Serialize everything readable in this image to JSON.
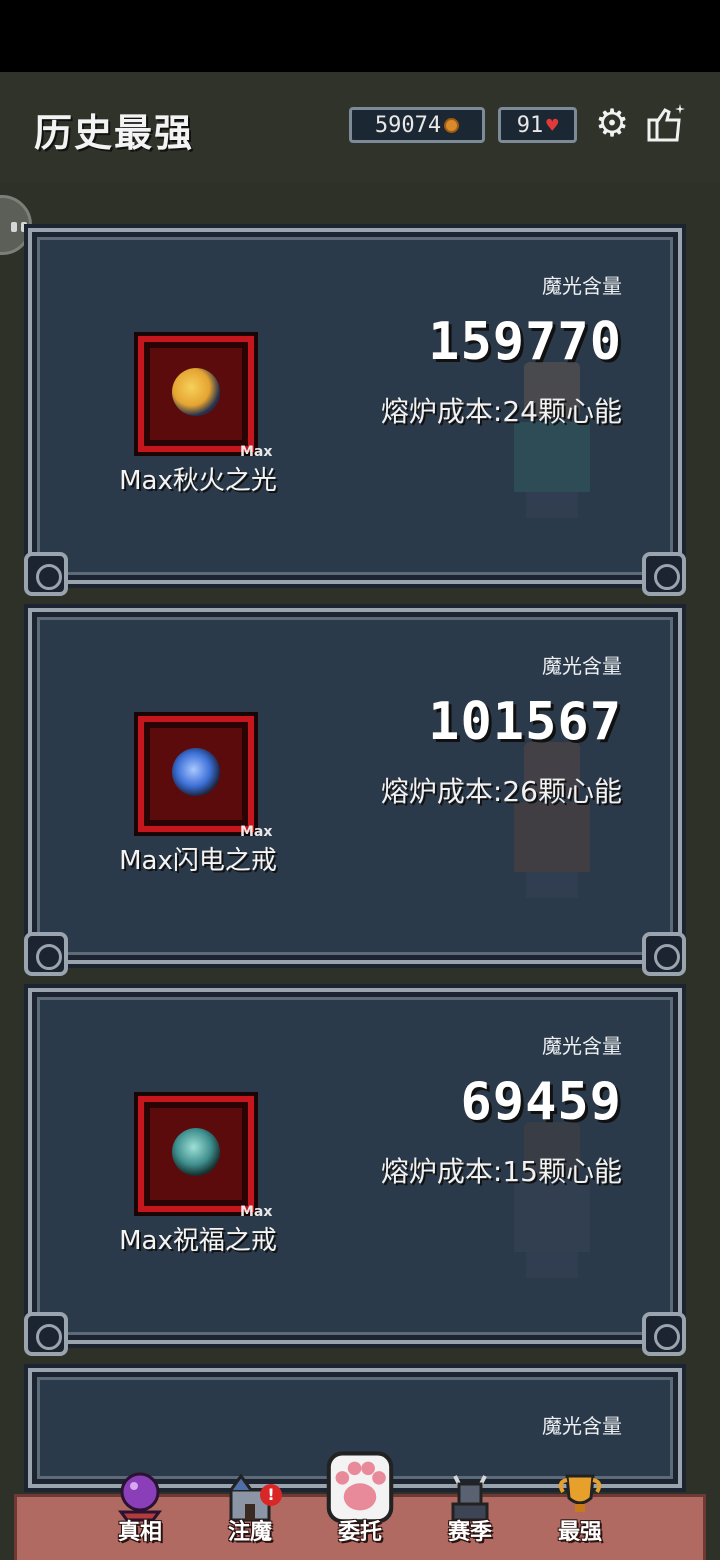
{
  "header": {
    "title": "历史最强",
    "coins": "59074",
    "hearts": "91",
    "settings_icon": "gear-icon",
    "like_icon": "thumbs-up-icon"
  },
  "cards": [
    {
      "mana_label": "魔光含量",
      "mana_value": "159770",
      "cost": "熔炉成本:24颗心能",
      "max_tag": "Max",
      "item_name": "Max秋火之光",
      "gem_color": "#e5a431"
    },
    {
      "mana_label": "魔光含量",
      "mana_value": "101567",
      "cost": "熔炉成本:26颗心能",
      "max_tag": "Max",
      "item_name": "Max闪电之戒",
      "gem_color": "#3c6fd6"
    },
    {
      "mana_label": "魔光含量",
      "mana_value": "69459",
      "cost": "熔炉成本:15颗心能",
      "max_tag": "Max",
      "item_name": "Max祝福之戒",
      "gem_color": "#3f8f8f"
    },
    {
      "mana_label": "魔光含量"
    }
  ],
  "bottom_nav": {
    "items": [
      {
        "label": "真相",
        "icon": "crystal-ball-icon"
      },
      {
        "label": "注魔",
        "icon": "castle-icon",
        "badge": "!"
      },
      {
        "label": "委托",
        "icon": "paw-icon"
      },
      {
        "label": "赛季",
        "icon": "warrior-icon"
      },
      {
        "label": "最强",
        "icon": "trophy-icon"
      }
    ],
    "active_index": 2
  },
  "colors": {
    "background": "#2d3128",
    "card_bg": "#2b3a4a",
    "item_frame": "#c4161c",
    "nav_bar": "#b06a62"
  }
}
